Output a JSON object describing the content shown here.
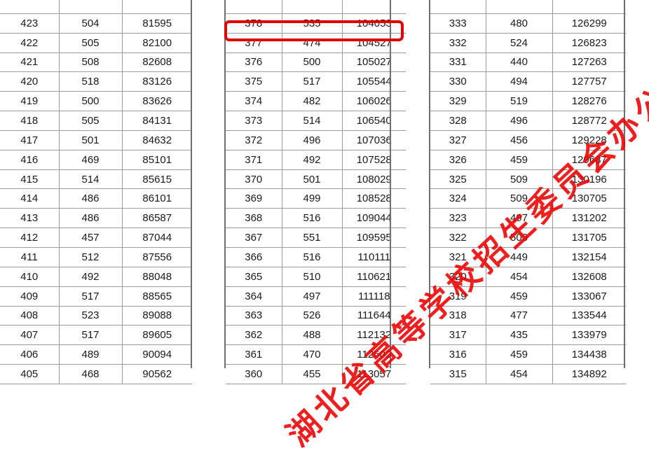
{
  "tables": [
    {
      "rows": [
        [
          "",
          "",
          ""
        ],
        [
          "423",
          "504",
          "81595"
        ],
        [
          "422",
          "505",
          "82100"
        ],
        [
          "421",
          "508",
          "82608"
        ],
        [
          "420",
          "518",
          "83126"
        ],
        [
          "419",
          "500",
          "83626"
        ],
        [
          "418",
          "505",
          "84131"
        ],
        [
          "417",
          "501",
          "84632"
        ],
        [
          "416",
          "469",
          "85101"
        ],
        [
          "415",
          "514",
          "85615"
        ],
        [
          "414",
          "486",
          "86101"
        ],
        [
          "413",
          "486",
          "86587"
        ],
        [
          "412",
          "457",
          "87044"
        ],
        [
          "411",
          "512",
          "87556"
        ],
        [
          "410",
          "492",
          "88048"
        ],
        [
          "409",
          "517",
          "88565"
        ],
        [
          "408",
          "523",
          "89088"
        ],
        [
          "407",
          "517",
          "89605"
        ],
        [
          "406",
          "489",
          "90094"
        ],
        [
          "405",
          "468",
          "90562"
        ]
      ]
    },
    {
      "rows": [
        [
          "",
          "",
          ""
        ],
        [
          "378",
          "535",
          "104053"
        ],
        [
          "377",
          "474",
          "104527"
        ],
        [
          "376",
          "500",
          "105027"
        ],
        [
          "375",
          "517",
          "105544"
        ],
        [
          "374",
          "482",
          "106026"
        ],
        [
          "373",
          "514",
          "106540"
        ],
        [
          "372",
          "496",
          "107036"
        ],
        [
          "371",
          "492",
          "107528"
        ],
        [
          "370",
          "501",
          "108029"
        ],
        [
          "369",
          "499",
          "108528"
        ],
        [
          "368",
          "516",
          "109044"
        ],
        [
          "367",
          "551",
          "109595"
        ],
        [
          "366",
          "516",
          "110111"
        ],
        [
          "365",
          "510",
          "110621"
        ],
        [
          "364",
          "497",
          "111118"
        ],
        [
          "363",
          "526",
          "111644"
        ],
        [
          "362",
          "488",
          "112132"
        ],
        [
          "361",
          "470",
          "112602"
        ],
        [
          "360",
          "455",
          "113057"
        ]
      ]
    },
    {
      "rows": [
        [
          "",
          "",
          ""
        ],
        [
          "333",
          "480",
          "126299"
        ],
        [
          "332",
          "524",
          "126823"
        ],
        [
          "331",
          "440",
          "127263"
        ],
        [
          "330",
          "494",
          "127757"
        ],
        [
          "329",
          "519",
          "128276"
        ],
        [
          "328",
          "496",
          "128772"
        ],
        [
          "327",
          "456",
          "129228"
        ],
        [
          "326",
          "459",
          "129687"
        ],
        [
          "325",
          "509",
          "130196"
        ],
        [
          "324",
          "509",
          "130705"
        ],
        [
          "323",
          "497",
          "131202"
        ],
        [
          "322",
          "503",
          "131705"
        ],
        [
          "321",
          "449",
          "132154"
        ],
        [
          "320",
          "454",
          "132608"
        ],
        [
          "319",
          "459",
          "133067"
        ],
        [
          "318",
          "477",
          "133544"
        ],
        [
          "317",
          "435",
          "133979"
        ],
        [
          "316",
          "459",
          "134438"
        ],
        [
          "315",
          "454",
          "134892"
        ]
      ]
    }
  ],
  "highlight": {
    "color": "#e00000"
  },
  "watermark": {
    "text": "湖北省高等学校招生委员会办公室",
    "color": "#eb0000"
  }
}
